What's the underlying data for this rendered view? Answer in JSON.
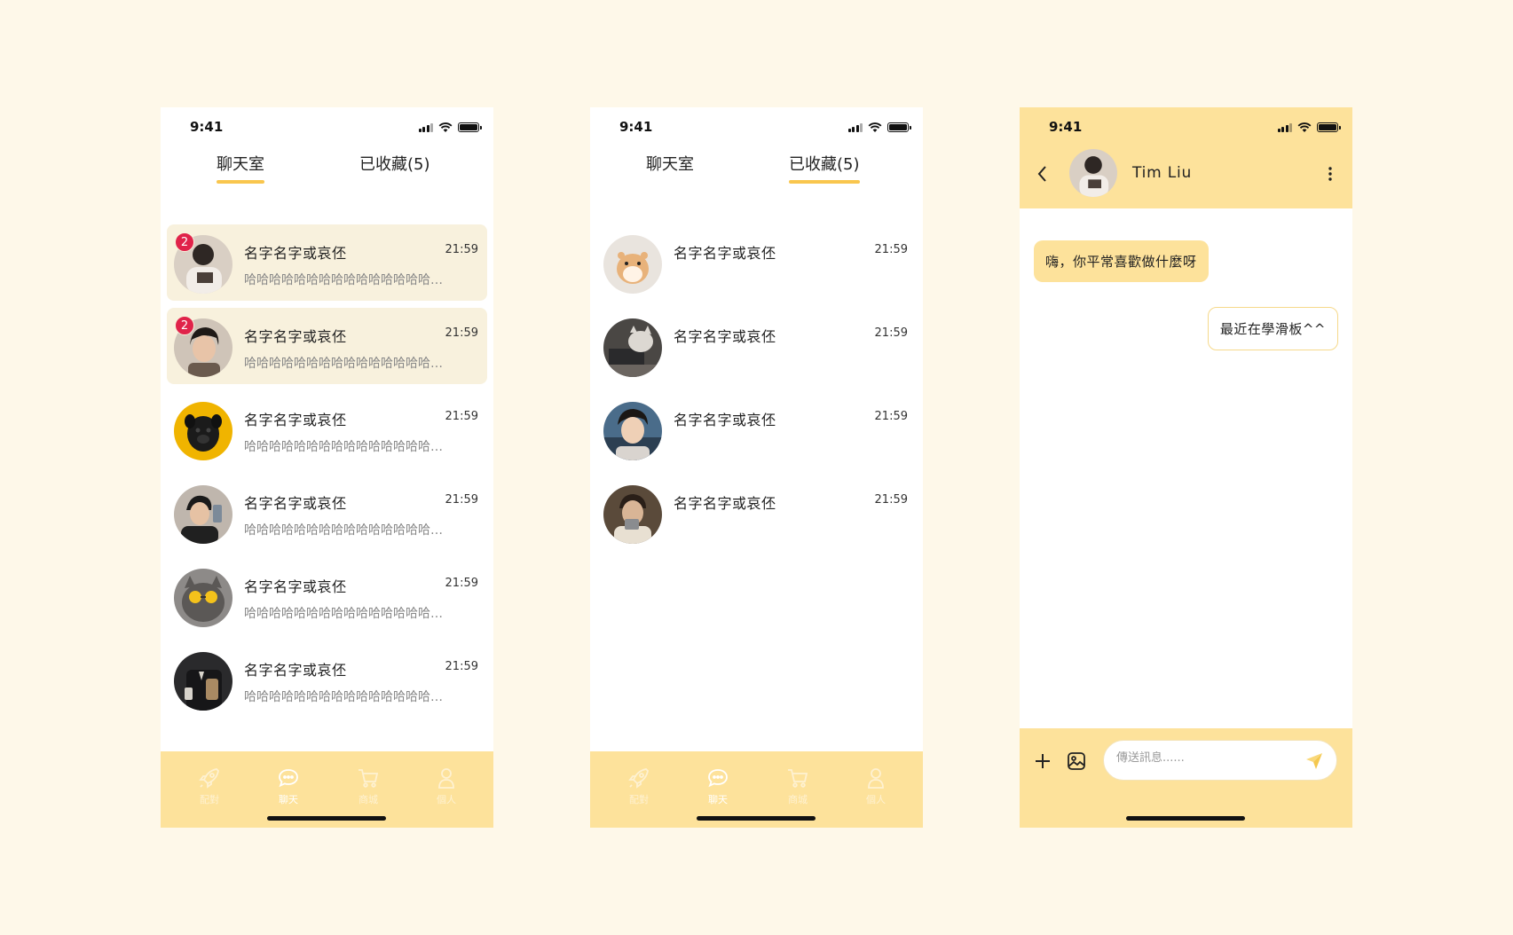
{
  "status": {
    "time": "9:41"
  },
  "tabs": {
    "chat_room": "聊天室",
    "favorites": "已收藏(5)"
  },
  "chat_list": [
    {
      "name": "名字名字或哀伾",
      "time": "21:59",
      "preview": "哈哈哈哈哈哈哈哈哈哈哈哈哈哈哈…",
      "unread": "2",
      "avatar": "avatar-1"
    },
    {
      "name": "名字名字或哀伾",
      "time": "21:59",
      "preview": "哈哈哈哈哈哈哈哈哈哈哈哈哈哈哈…",
      "unread": "2",
      "avatar": "avatar-2"
    },
    {
      "name": "名字名字或哀伾",
      "time": "21:59",
      "preview": "哈哈哈哈哈哈哈哈哈哈哈哈哈哈哈…",
      "avatar": "avatar-dog"
    },
    {
      "name": "名字名字或哀伾",
      "time": "21:59",
      "preview": "哈哈哈哈哈哈哈哈哈哈哈哈哈哈哈…",
      "avatar": "avatar-4"
    },
    {
      "name": "名字名字或哀伾",
      "time": "21:59",
      "preview": "哈哈哈哈哈哈哈哈哈哈哈哈哈哈哈…",
      "avatar": "avatar-cat"
    },
    {
      "name": "名字名字或哀伾",
      "time": "21:59",
      "preview": "哈哈哈哈哈哈哈哈哈哈哈哈哈哈哈…",
      "avatar": "avatar-6"
    }
  ],
  "favorites_list": [
    {
      "name": "名字名字或哀伾",
      "time": "21:59",
      "avatar": "avatar-hamster"
    },
    {
      "name": "名字名字或哀伾",
      "time": "21:59",
      "avatar": "avatar-cat-laptop"
    },
    {
      "name": "名字名字或哀伾",
      "time": "21:59",
      "avatar": "avatar-man"
    },
    {
      "name": "名字名字或哀伾",
      "time": "21:59",
      "avatar": "avatar-man-2"
    }
  ],
  "nav": {
    "match": "配對",
    "chat": "聊天",
    "shop": "商城",
    "profile": "個人"
  },
  "conversation": {
    "contact_name": "Tim Liu",
    "messages": [
      {
        "from": "them",
        "text": "嗨，你平常喜歡做什麼呀"
      },
      {
        "from": "me",
        "text": "最近在學滑板^^"
      }
    ],
    "input_placeholder": "傳送訊息......"
  },
  "colors": {
    "background": "#fef8e9",
    "accent": "#fde29b",
    "underline": "#f9c64e",
    "badge": "#e0234a",
    "unread_row": "#f8f1dd"
  }
}
